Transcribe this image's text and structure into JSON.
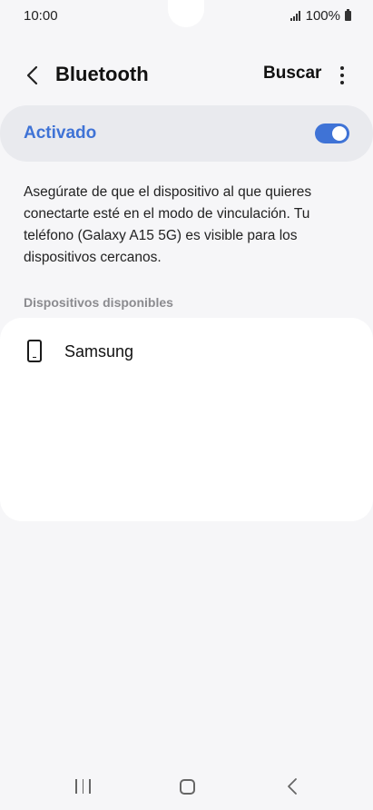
{
  "status_bar": {
    "time": "10:00",
    "battery": "100%",
    "icons": [
      "signal-icon",
      "battery-icon"
    ]
  },
  "app_bar": {
    "title": "Bluetooth",
    "search_label": "Buscar",
    "icons": [
      "back-icon",
      "more-options-icon"
    ]
  },
  "toggle": {
    "label": "Activado",
    "state": "on",
    "accent_color": "#3f73d6"
  },
  "description": "Asegúrate de que el dispositivo al que quieres conectarte esté en el modo de vinculación. Tu teléfono (Galaxy A15 5G) es visible para los dispositivos cercanos.",
  "available_devices": {
    "header": "Dispositivos disponibles",
    "items": [
      {
        "name": "Samsung",
        "icon": "phone-icon"
      }
    ]
  },
  "nav_bar": {
    "icons": [
      "recents-icon",
      "home-icon",
      "back-nav-icon"
    ]
  }
}
